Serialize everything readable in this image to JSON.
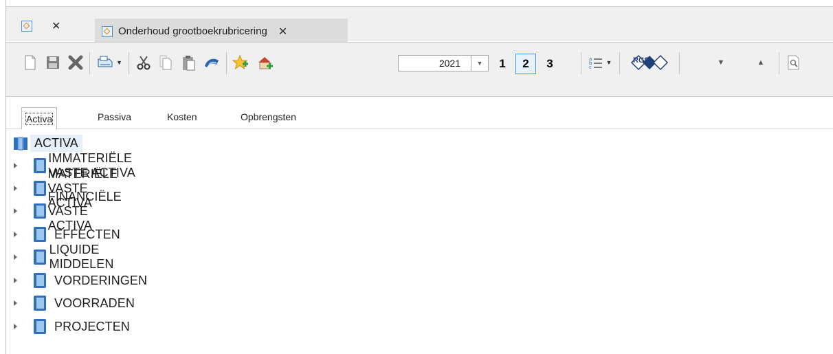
{
  "tabs": {
    "home_close": "✕",
    "active_title": "Onderhoud grootboekrubricering",
    "active_close": "✕"
  },
  "toolbar": {
    "year": "2021",
    "levels": [
      "1",
      "2",
      "3"
    ],
    "selected_level": "2",
    "rgs_label": "RGS",
    "icons": [
      "new-icon",
      "save-icon",
      "delete-icon",
      "print-icon",
      "cut-icon",
      "copy-icon",
      "paste-icon",
      "undo-icon",
      "favorite-icon",
      "home-add-icon",
      "list-icon",
      "rgs-icon",
      "collapse-icon",
      "expand-icon",
      "preview-icon"
    ]
  },
  "subtabs": [
    "Activa",
    "Passiva",
    "Kosten",
    "Opbrengsten"
  ],
  "tree": {
    "root": "ACTIVA",
    "items": [
      "IMMATERIËLE VASTE ACTIVA",
      "MATERIËLE VASTE ACTIVA",
      "FINANCIËLE VASTE ACTIVA",
      "EFFECTEN",
      "LIQUIDE MIDDELEN",
      "VORDERINGEN",
      "VOORRADEN",
      "PROJECTEN"
    ]
  }
}
